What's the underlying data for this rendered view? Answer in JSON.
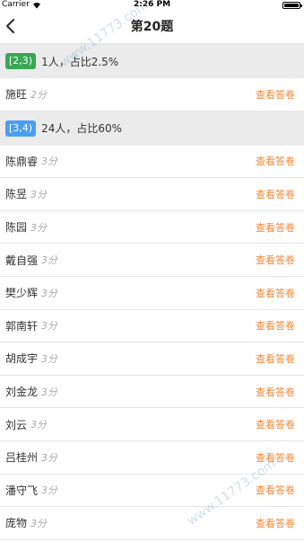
{
  "status_bar": {
    "carrier": "Carrier",
    "time": "2:26 PM"
  },
  "nav": {
    "title": "第20题"
  },
  "groups": [
    {
      "badge": "[2,3)",
      "badge_color": "#3aa757",
      "summary": "1人，占比2.5%",
      "rows": [
        {
          "name": "施旺",
          "score": "2分",
          "action": "查看答卷"
        }
      ]
    },
    {
      "badge": "[3,4)",
      "badge_color": "#4a9ef1",
      "summary": "24人，占比60%",
      "rows": [
        {
          "name": "陈鼎睿",
          "score": "3分",
          "action": "查看答卷"
        },
        {
          "name": "陈昱",
          "score": "3分",
          "action": "查看答卷"
        },
        {
          "name": "陈园",
          "score": "3分",
          "action": "查看答卷"
        },
        {
          "name": "戴自强",
          "score": "3分",
          "action": "查看答卷"
        },
        {
          "name": "樊少辉",
          "score": "3分",
          "action": "查看答卷"
        },
        {
          "name": "郭南轩",
          "score": "3分",
          "action": "查看答卷"
        },
        {
          "name": "胡成宇",
          "score": "3分",
          "action": "查看答卷"
        },
        {
          "name": "刘金龙",
          "score": "3分",
          "action": "查看答卷"
        },
        {
          "name": "刘云",
          "score": "3分",
          "action": "查看答卷"
        },
        {
          "name": "吕桂州",
          "score": "3分",
          "action": "查看答卷"
        },
        {
          "name": "潘守飞",
          "score": "3分",
          "action": "查看答卷"
        },
        {
          "name": "庞物",
          "score": "3分",
          "action": "查看答卷"
        }
      ]
    }
  ],
  "watermark": {
    "top": "www.11773.com",
    "bottom": "www.11773.com"
  }
}
